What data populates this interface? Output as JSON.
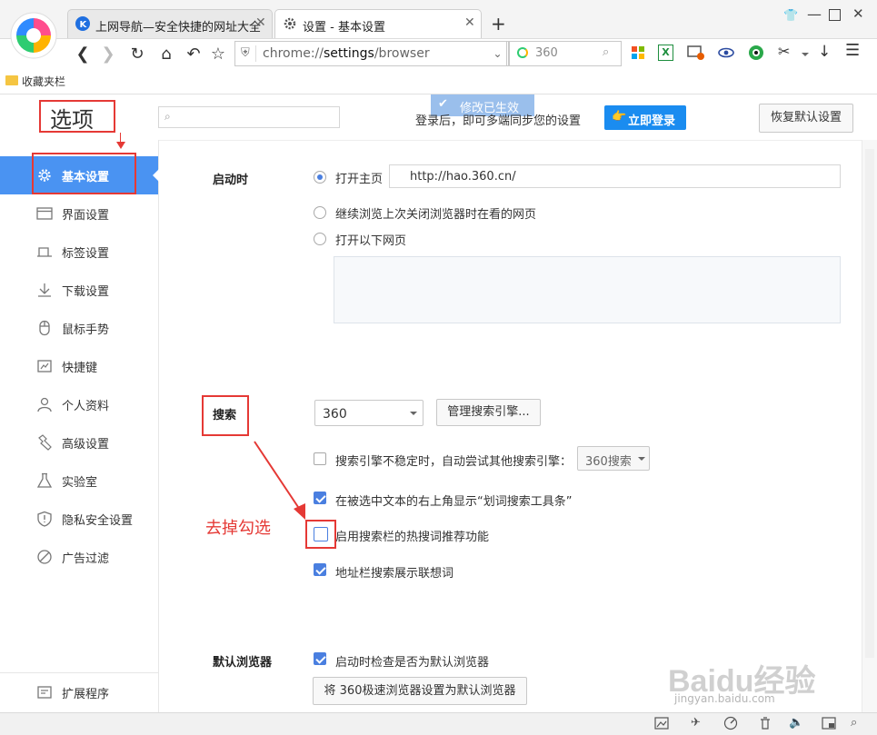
{
  "browser": {
    "tabs": [
      {
        "title": "上网导航—安全快捷的网址大全",
        "active": false
      },
      {
        "title": "设置 - 基本设置",
        "active": true
      }
    ],
    "new_tab": "+",
    "address": {
      "scheme": "chrome://",
      "host": "settings",
      "path": "/browser"
    },
    "search": {
      "engine_label": "360"
    },
    "bookmarks_label": "收藏夹栏"
  },
  "settings": {
    "title": "选项",
    "toast": "修改已生效",
    "login_hint": "登录后，即可多端同步您的设置",
    "login_button": "立即登录",
    "restore_button": "恢复默认设置",
    "sidebar": [
      {
        "label": "基本设置",
        "icon": "gear-icon",
        "active": true
      },
      {
        "label": "界面设置",
        "icon": "window-icon"
      },
      {
        "label": "标签设置",
        "icon": "tab-icon"
      },
      {
        "label": "下载设置",
        "icon": "download-icon"
      },
      {
        "label": "鼠标手势",
        "icon": "mouse-icon"
      },
      {
        "label": "快捷键",
        "icon": "keyboard-icon"
      },
      {
        "label": "个人资料",
        "icon": "person-icon"
      },
      {
        "label": "高级设置",
        "icon": "wrench-icon"
      },
      {
        "label": "实验室",
        "icon": "flask-icon"
      },
      {
        "label": "隐私安全设置",
        "icon": "shield-icon"
      },
      {
        "label": "广告过滤",
        "icon": "block-icon"
      }
    ],
    "extensions": {
      "label": "扩展程序",
      "icon": "extension-icon"
    },
    "startup": {
      "title": "启动时",
      "open_home_label": "打开主页",
      "home_url": "http://hao.360.cn/",
      "continue_label": "继续浏览上次关闭浏览器时在看的网页",
      "open_pages_label": "打开以下网页"
    },
    "search": {
      "title": "搜索",
      "engine": "360",
      "manage_button": "管理搜索引擎...",
      "fallback_label": "搜索引擎不稳定时，自动尝试其他搜索引擎：",
      "fallback_engine": "360搜索",
      "show_toolbar_label": "在被选中文本的右上角显示“划词搜索工具条”",
      "hot_words_label": "启用搜索栏的热搜词推荐功能",
      "suggest_label": "地址栏搜索展示联想词"
    },
    "default_browser": {
      "title": "默认浏览器",
      "check_label": "启动时检查是否为默认浏览器",
      "set_button": "将 360极速浏览器设置为默认浏览器"
    },
    "annotation": "去掉勾选"
  },
  "watermark": {
    "brand": "Baidu经验",
    "url": "jingyan.baidu.com"
  },
  "colors": {
    "accent": "#4a93f2",
    "annotation": "#e53935",
    "login": "#1a8cf0"
  }
}
